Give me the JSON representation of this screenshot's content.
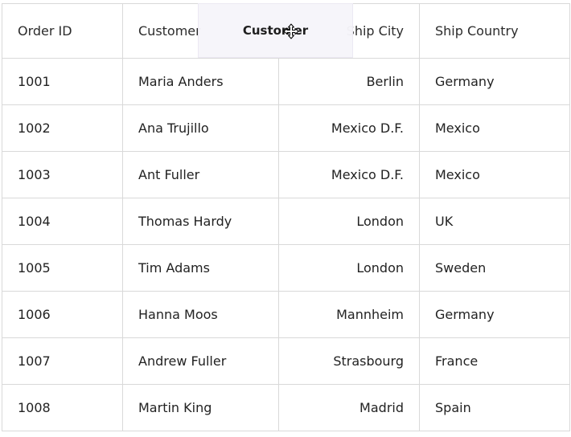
{
  "grid": {
    "columns": [
      "Order ID",
      "Customer",
      "Ship City",
      "Ship Country"
    ],
    "rows": [
      [
        "1001",
        "Maria Anders",
        "Berlin",
        "Germany"
      ],
      [
        "1002",
        "Ana Trujillo",
        "Mexico D.F.",
        "Mexico"
      ],
      [
        "1003",
        "Ant Fuller",
        "Mexico D.F.",
        "Mexico"
      ],
      [
        "1004",
        "Thomas Hardy",
        "London",
        "UK"
      ],
      [
        "1005",
        "Tim Adams",
        "London",
        "Sweden"
      ],
      [
        "1006",
        "Hanna Moos",
        "Mannheim",
        "Germany"
      ],
      [
        "1007",
        "Andrew Fuller",
        "Strasbourg",
        "France"
      ],
      [
        "1008",
        "Martin King",
        "Madrid",
        "Spain"
      ]
    ]
  },
  "drag": {
    "label": "Customer",
    "cursor_icon": "move-cursor-icon"
  }
}
